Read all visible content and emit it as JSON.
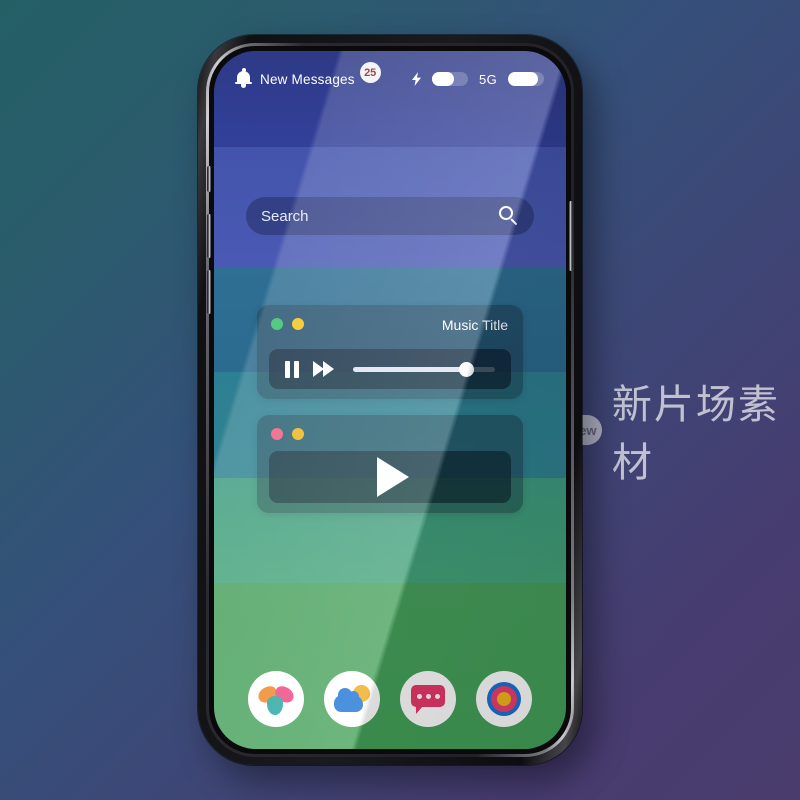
{
  "watermark": {
    "badge": "new",
    "text": "新片场素材"
  },
  "statusbar": {
    "bell_icon": "bell-icon",
    "label": "New Messages",
    "badge_count": "25",
    "charging_icon": "lightning-bolt-icon",
    "battery_icon": "battery-pill-icon",
    "network_label": "5G",
    "signal_icon": "signal-pill-icon"
  },
  "search": {
    "placeholder": "Search",
    "value": "",
    "icon": "search-icon"
  },
  "music_card": {
    "title": "Music Title",
    "dot_colors": [
      "#33c06a",
      "#f0c419"
    ],
    "pause_icon": "pause-icon",
    "forward_icon": "fast-forward-icon",
    "progress_percent": "80"
  },
  "video_card": {
    "dot_colors": [
      "#ef5a7e",
      "#f0b419"
    ],
    "play_icon": "play-icon"
  },
  "dock": {
    "apps": [
      {
        "name": "flower-app",
        "icon": "flower-icon"
      },
      {
        "name": "weather-app",
        "icon": "cloud-sun-icon"
      },
      {
        "name": "messages-app",
        "icon": "chat-bubble-icon"
      },
      {
        "name": "target-app",
        "icon": "target-rings-icon"
      }
    ]
  },
  "device": {
    "buttons": [
      "mute-switch",
      "volume-up-button",
      "volume-down-button",
      "power-button"
    ]
  },
  "colors": {
    "wallpaper_band_1": "#2e3a86",
    "wallpaper_band_2": "#4354ad",
    "wallpaper_band_3": "#2e6f93",
    "wallpaper_band_4": "#2d7f93",
    "wallpaper_band_5": "#3d9c80",
    "wallpaper_band_6": "#47a05c",
    "backdrop_start": "#245f66",
    "backdrop_end": "#473c70",
    "badge_text": "#8e2230"
  }
}
